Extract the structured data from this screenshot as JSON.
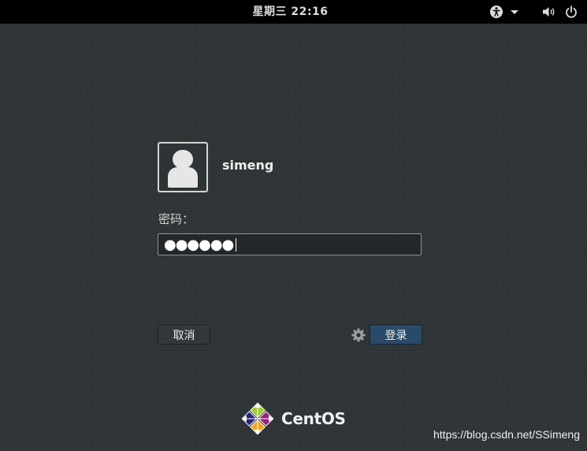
{
  "topbar": {
    "clock": "星期三 22:16",
    "icons": [
      "accessibility-icon",
      "dropdown-arrow-icon",
      "volume-icon",
      "power-icon"
    ]
  },
  "user": {
    "name": "simeng",
    "avatar_icon": "user-avatar-icon"
  },
  "password": {
    "label": "密码：",
    "value_masked": "●●●●●●"
  },
  "buttons": {
    "cancel": "取消",
    "login": "登录"
  },
  "session_icon": "gear-icon",
  "logo": {
    "text": "CentOS"
  },
  "watermark": "https://blog.csdn.net/SSimeng",
  "colors": {
    "background": "#2e3436",
    "topbar": "#000000",
    "login_button": "#2a4a6a"
  }
}
